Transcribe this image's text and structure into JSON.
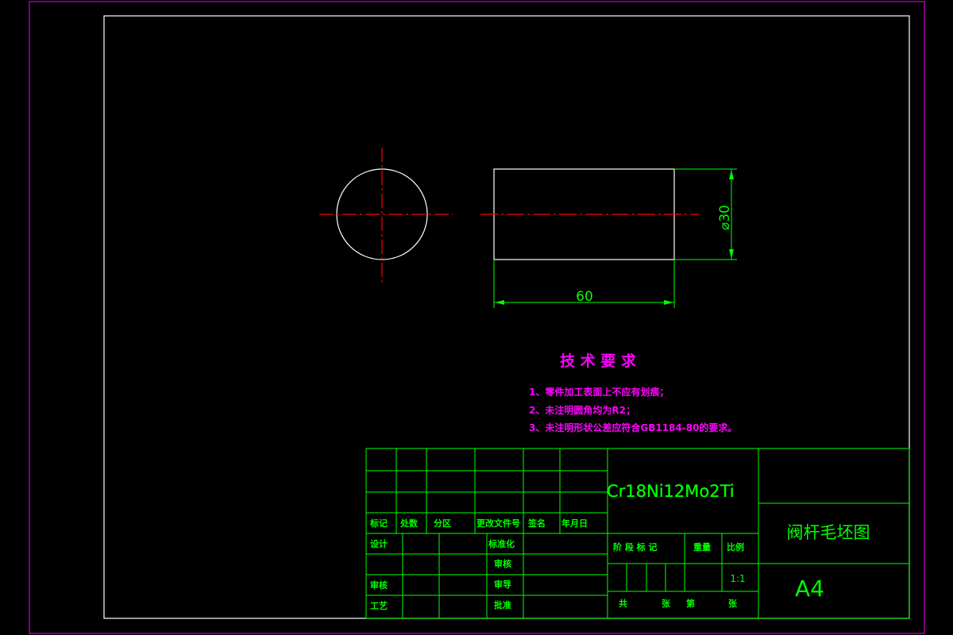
{
  "drawing": {
    "diameter_label": "⌀30",
    "length_label": "60"
  },
  "requirements": {
    "title": "技 术 要 求",
    "items": [
      "1、零件加工表面上不应有划痕；",
      "2、未注明圆角均为R2；",
      "3、未注明形状公差应符合GB1184-80的要求。"
    ]
  },
  "title_block": {
    "material": "Cr18Ni12Mo2Ti",
    "part_name": "阀杆毛坯图",
    "paper_size": "A4",
    "scale": "1:1",
    "rev_headers": [
      "标记",
      "处数",
      "分区",
      "更改文件号",
      "签名",
      "年月日"
    ],
    "left_labels": {
      "design": "设计",
      "review": "审核",
      "process": "工艺",
      "standardize": "标准化",
      "catalog": "审核",
      "audit": "审导",
      "approve": "批准"
    },
    "stage_headers": [
      "阶 段 标 记",
      "重量",
      "比例"
    ],
    "sheet_footer": [
      "共",
      "张",
      "第",
      "张"
    ]
  },
  "colors": {
    "border_outer": "#cc00cc",
    "border_inner": "#ffffff",
    "geometry": "#ffffff",
    "centerline": "#ff0000",
    "dimension": "#00ff00",
    "notes": "#ff00ff",
    "title_block": "#00ff00"
  }
}
